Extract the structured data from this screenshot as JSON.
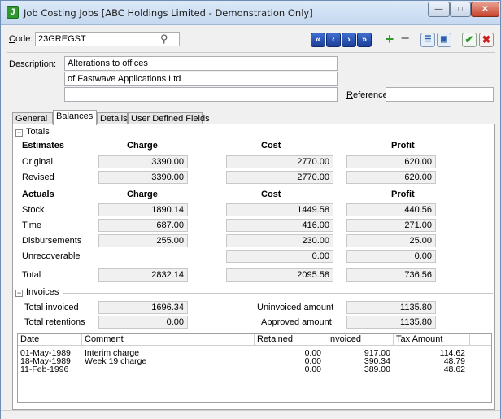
{
  "window": {
    "title": "Job Costing Jobs [ABC Holdings Limited - Demonstration Only]"
  },
  "header": {
    "code_label": "Code:",
    "code_value": "23GREGST",
    "description_label": "Description:",
    "description_lines": [
      "Alterations to offices",
      "of Fastwave Applications Ltd",
      ""
    ],
    "reference_label": "Reference:",
    "reference_value": ""
  },
  "tabs": [
    "General",
    "Balances",
    "Details",
    "User Defined Fields"
  ],
  "active_tab": "Balances",
  "totals": {
    "group_label": "Totals",
    "estimates_header": "Estimates",
    "actuals_header": "Actuals",
    "columns": {
      "charge": "Charge",
      "cost": "Cost",
      "profit": "Profit"
    },
    "estimates": [
      {
        "label": "Original",
        "charge": "3390.00",
        "cost": "2770.00",
        "profit": "620.00"
      },
      {
        "label": "Revised",
        "charge": "3390.00",
        "cost": "2770.00",
        "profit": "620.00"
      }
    ],
    "actuals": [
      {
        "label": "Stock",
        "charge": "1890.14",
        "cost": "1449.58",
        "profit": "440.56"
      },
      {
        "label": "Time",
        "charge": "687.00",
        "cost": "416.00",
        "profit": "271.00"
      },
      {
        "label": "Disbursements",
        "charge": "255.00",
        "cost": "230.00",
        "profit": "25.00"
      },
      {
        "label": "Unrecoverable",
        "charge": "",
        "cost": "0.00",
        "profit": "0.00"
      }
    ],
    "total": {
      "label": "Total",
      "charge": "2832.14",
      "cost": "2095.58",
      "profit": "736.56"
    }
  },
  "invoices": {
    "group_label": "Invoices",
    "total_invoiced_label": "Total invoiced",
    "total_invoiced": "1696.34",
    "total_retentions_label": "Total retentions",
    "total_retentions": "0.00",
    "uninvoiced_label": "Uninvoiced amount",
    "uninvoiced": "1135.80",
    "approved_label": "Approved amount",
    "approved": "1135.80",
    "grid_columns": [
      "Date",
      "Comment",
      "Retained",
      "Invoiced",
      "Tax Amount"
    ],
    "rows": [
      {
        "date": "01-May-1989",
        "comment": "Interim charge",
        "retained": "0.00",
        "invoiced": "917.00",
        "tax": "114.62"
      },
      {
        "date": "18-May-1989",
        "comment": "Week 19 charge",
        "retained": "0.00",
        "invoiced": "390.34",
        "tax": "48.79"
      },
      {
        "date": "11-Feb-1996",
        "comment": "",
        "retained": "0.00",
        "invoiced": "389.00",
        "tax": "48.62"
      }
    ]
  },
  "colors": {
    "nav_button": "#2a55b8",
    "add_button": "#2e9a2e",
    "ok_button": "#2a9a2a",
    "cancel_button": "#c81e1e",
    "app_icon": "#2e9a2e"
  }
}
